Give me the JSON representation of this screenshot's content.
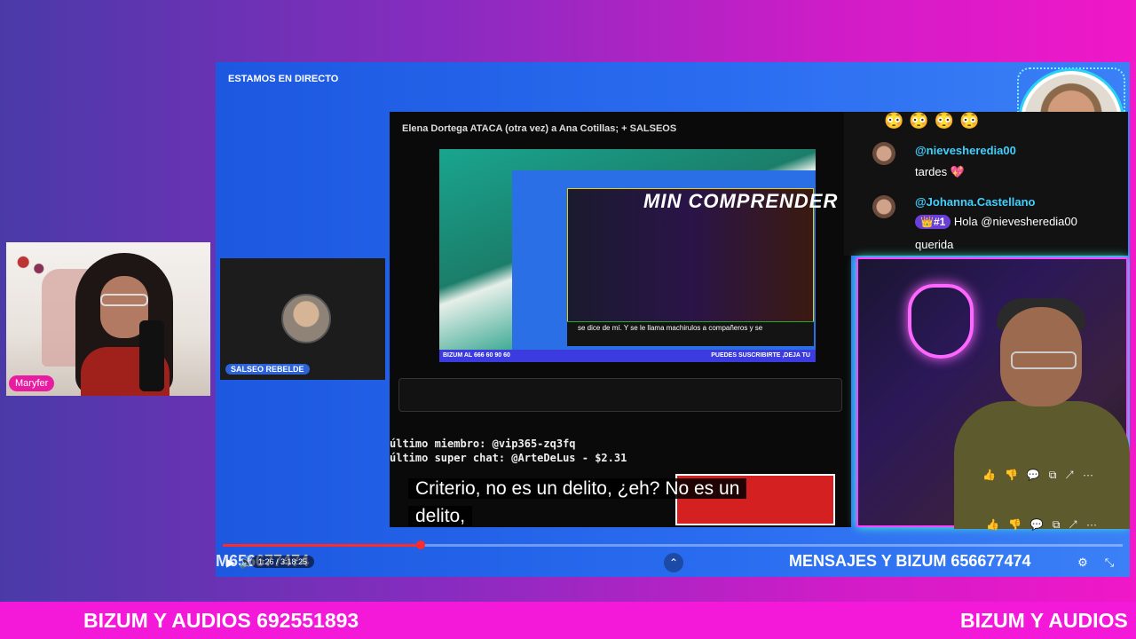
{
  "left_cam": {
    "name": "Maryfer"
  },
  "stream": {
    "title": "ESTAMOS EN DIRECTO",
    "guest_label": "SALSEO REBELDE",
    "embedded_video_title": "Elena Dortega ATACA (otra vez) a Ana Cotillas; + SALSEOS",
    "embedded_banner": "MIN COMPRENDER",
    "embedded_caption": "se dice de mí. Y se le llama machirulos a compañeros y se",
    "bizum_strip_left": "BIZUM AL 666 60 90 60",
    "bizum_strip_right": "PUEDES SUSCRIBIRTE ,DEJA TU",
    "stats": {
      "last_member": "último miembro: @vip365-zq3fq",
      "last_superchat": "último super chat: @ArteDeLus - $2.31"
    },
    "chat": {
      "emojis": "😳😳😳😳",
      "msg1_user": "@nievesheredia00",
      "msg1_text": "tardes",
      "msg1_emoji": "💖",
      "msg2_user": "@Johanna.Castellano",
      "msg2_badge": "👑#1",
      "msg2_text": "Hola @nievesheredia00",
      "msg2_text2": "querida"
    },
    "subtitle_line1": "Criterio, no es un delito, ¿eh? No es un",
    "subtitle_line2": "delito,",
    "progress": 0.22,
    "controls": {
      "ticker_left": "M656677474",
      "time": "1:26 / 3:18:25",
      "ticker_right": "MENSAJES Y BIZUM 656677474",
      "play_icon": "▶",
      "volume_icon": "🔊",
      "chevron_icon": "⌃",
      "settings_icon": "⚙",
      "fullscreen_icon": "⤡"
    }
  },
  "bottom_banner": {
    "text1": "BIZUM Y AUDIOS 692551893",
    "text2": "BIZUM Y AUDIOS"
  }
}
